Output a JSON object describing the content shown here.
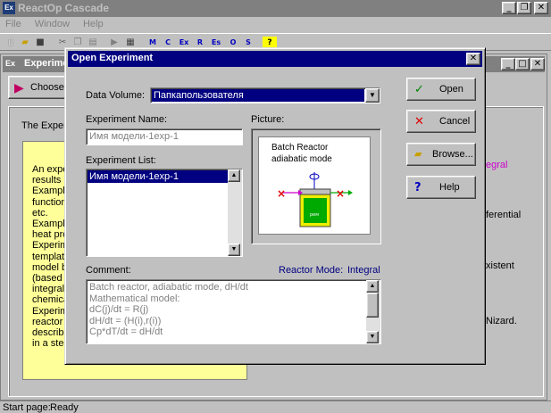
{
  "app": {
    "title": "ReactOp Cascade",
    "menu": [
      "File",
      "Window",
      "Help"
    ],
    "toolbar_letters": [
      "M",
      "C",
      "Ex",
      "R",
      "Es",
      "O",
      "S"
    ],
    "help_glyph": "?"
  },
  "child_window": {
    "title": "Experime",
    "choose_label": "Choose",
    "intro": "The Exper",
    "yellow_lines": [
      "An expe",
      "results c",
      "Example",
      "function",
      "etc.",
      "Example",
      "heat pro",
      "Experim",
      "template",
      "model b",
      "(based c",
      "integral",
      "chemica",
      "Experim",
      "reactor",
      "describe",
      "in a steady-state mode."
    ],
    "right_fragments": [
      "egral",
      "ferential",
      "xistent",
      "Nizard."
    ]
  },
  "dialog": {
    "title": "Open Experiment",
    "data_volume_label": "Data Volume:",
    "data_volume_value": "Папкапользователя",
    "experiment_name_label": "Experiment Name:",
    "experiment_name_value": "Имя модели-1exp-1",
    "experiment_list_label": "Experiment List:",
    "experiment_list_items": [
      "Имя модели-1exp-1"
    ],
    "picture_label": "Picture:",
    "picture_title_1": "Batch Reactor",
    "picture_title_2": "adiabatic mode",
    "comment_label": "Comment:",
    "reactor_mode_label": "Reactor Mode:",
    "reactor_mode_value": "Integral",
    "comment_lines": [
      "Batch reactor, adiabatic mode, dH/dt",
      "Mathematical model:",
      "dC(j)/dt = R(j)",
      "dH/dt = (H(i),r(i))",
      "Cp*dT/dt = dH/dt"
    ],
    "buttons": {
      "open": "Open",
      "cancel": "Cancel",
      "browse": "Browse...",
      "help": "Help"
    }
  },
  "status": {
    "label": "Start page:",
    "value": "Ready"
  },
  "colors": {
    "title_active": "#000080",
    "title_inactive": "#808080",
    "highlight": "#000080",
    "yellow_panel": "#ffff99",
    "reactor_green": "#00aa00",
    "arrow_red": "#e00000"
  }
}
